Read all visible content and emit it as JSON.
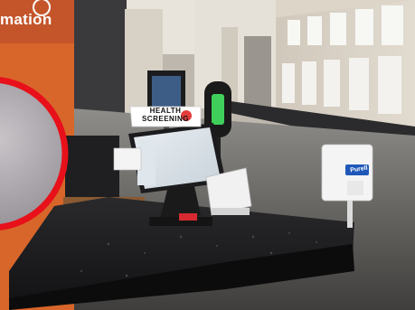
{
  "wall_sign": {
    "text": "mation"
  },
  "kiosk": {
    "sign_line1": "HEALTH",
    "sign_line2": "SCREENING"
  },
  "dispenser": {
    "brand": "Purell"
  },
  "colors": {
    "red_circle": "#e8101a",
    "counter_top": "#1a1a1c",
    "orange_pillar": "#d8662a",
    "stone_wall": "#d9d2c6"
  }
}
